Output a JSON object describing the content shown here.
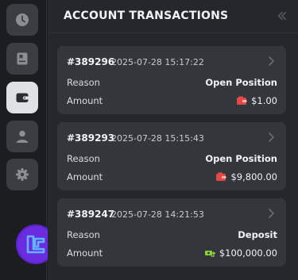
{
  "header": {
    "title": "ACCOUNT TRANSACTIONS"
  },
  "sidebar": {
    "items": [
      {
        "name": "history",
        "icon": "clock-icon",
        "active": false
      },
      {
        "name": "save",
        "icon": "bookmark-list-icon",
        "active": false
      },
      {
        "name": "wallet",
        "icon": "wallet-icon",
        "active": true
      },
      {
        "name": "profile",
        "icon": "user-icon",
        "active": false
      },
      {
        "name": "settings",
        "icon": "gear-icon",
        "active": false
      }
    ]
  },
  "labels": {
    "reason": "Reason",
    "amount": "Amount"
  },
  "transactions": [
    {
      "id": "#389296",
      "datetime": "2025-07-28 15:17:22",
      "reason": "Open Position",
      "amount": "$1.00",
      "type": "withdraw",
      "icon_color": "#e24848"
    },
    {
      "id": "#389293",
      "datetime": "2025-07-28 15:15:43",
      "reason": "Open Position",
      "amount": "$9,800.00",
      "type": "withdraw",
      "icon_color": "#e24848"
    },
    {
      "id": "#389247",
      "datetime": "2025-07-28 14:21:53",
      "reason": "Deposit",
      "amount": "$100,000.00",
      "type": "deposit",
      "icon_color": "#8ed23a"
    }
  ],
  "colors": {
    "accent": "#6b2be0",
    "withdraw": "#e24848",
    "deposit": "#8ed23a"
  }
}
